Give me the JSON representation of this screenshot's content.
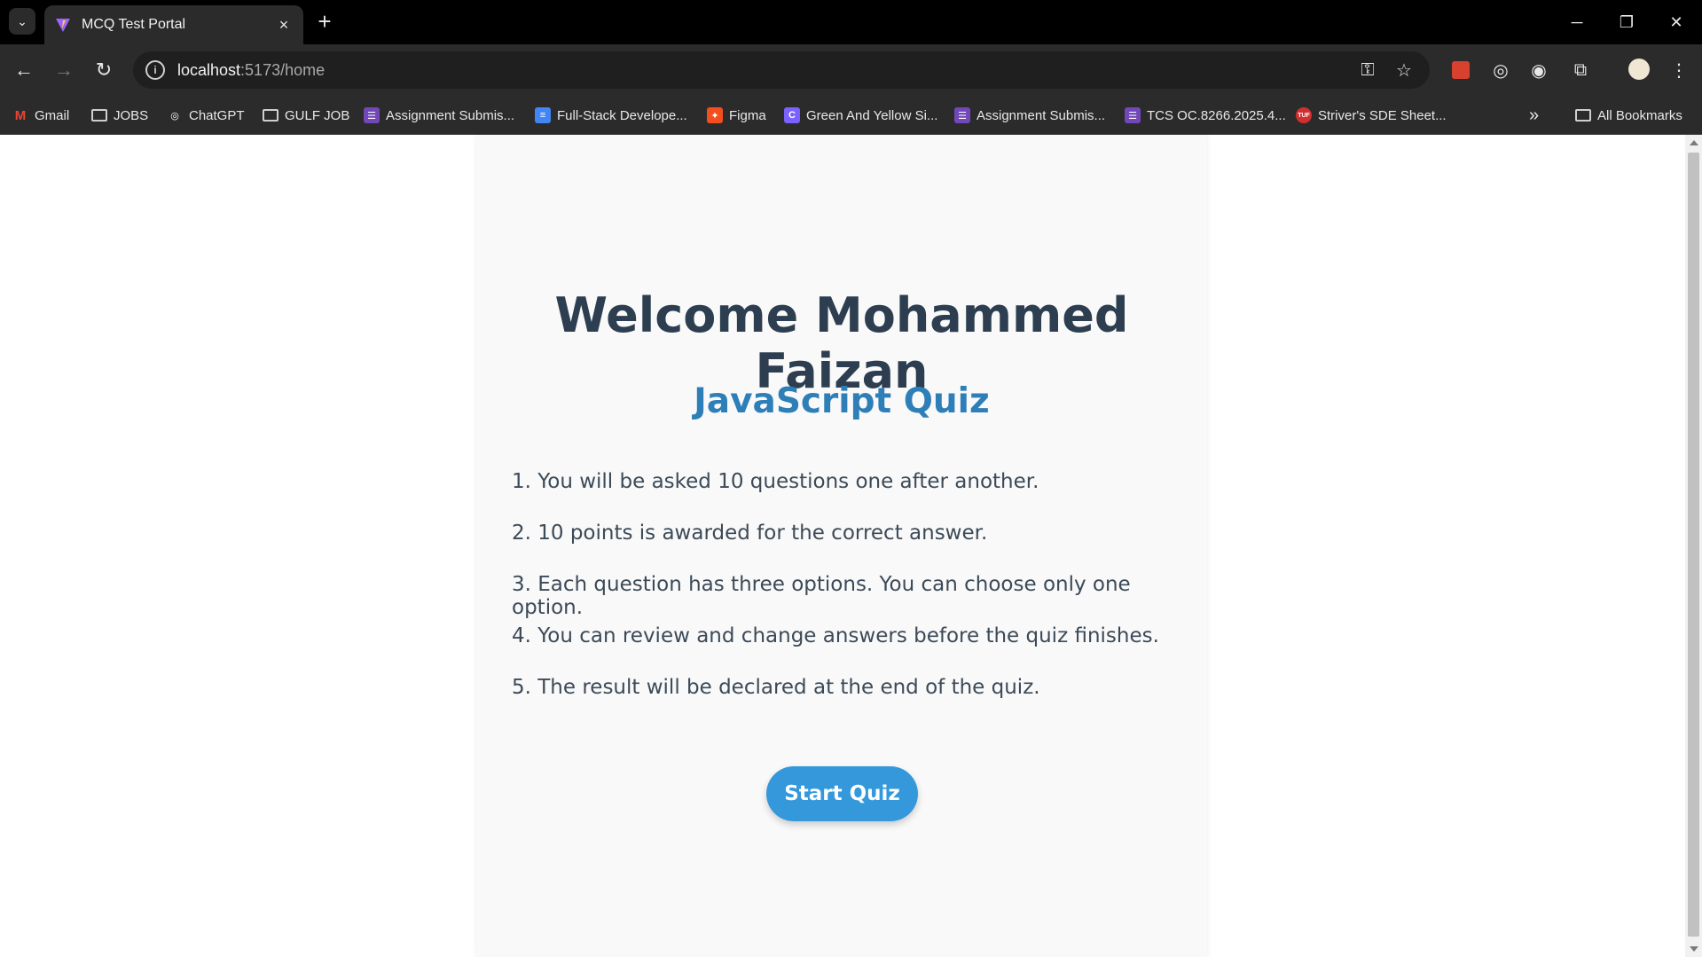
{
  "browser": {
    "tab_title": "MCQ Test Portal",
    "url_host": "localhost",
    "url_path": ":5173/home"
  },
  "bookmarks": [
    {
      "label": "Gmail",
      "icon": "gmail-icon",
      "color": "#ea4335",
      "glyph": "M"
    },
    {
      "label": "JOBS",
      "icon": "folder-icon",
      "color": "",
      "glyph": ""
    },
    {
      "label": "ChatGPT",
      "icon": "chatgpt-icon",
      "color": "#ffffff",
      "glyph": "◎"
    },
    {
      "label": "GULF JOB",
      "icon": "folder-icon",
      "color": "",
      "glyph": ""
    },
    {
      "label": "Assignment Submis...",
      "icon": "forms-icon",
      "color": "#7248b9",
      "glyph": "☰"
    },
    {
      "label": "Full-Stack Develope...",
      "icon": "docs-icon",
      "color": "#4285f4",
      "glyph": "≡"
    },
    {
      "label": "Figma",
      "icon": "figma-icon",
      "color": "#f24e1e",
      "glyph": "✦"
    },
    {
      "label": "Green And Yellow Si...",
      "icon": "canva-icon",
      "color": "#7b61ff",
      "glyph": "C"
    },
    {
      "label": "Assignment Submis...",
      "icon": "forms-icon",
      "color": "#7248b9",
      "glyph": "☰"
    },
    {
      "label": "TCS OC.8266.2025.4...",
      "icon": "forms-icon",
      "color": "#7248b9",
      "glyph": "☰"
    },
    {
      "label": "Striver's SDE Sheet...",
      "icon": "tuf-icon",
      "color": "#d32f2f",
      "glyph": "TUF"
    }
  ],
  "all_bookmarks_label": "All Bookmarks",
  "main": {
    "welcome": "Welcome Mohammed Faizan",
    "quiz_title": "JavaScript Quiz",
    "rules": [
      "1. You will be asked 10 questions one after another.",
      "2. 10 points is awarded for the correct answer.",
      "3. Each question has three options. You can choose only one option.",
      "4. You can review and change answers before the quiz finishes.",
      "5. The result will be declared at the end of the quiz."
    ],
    "start_button": "Start Quiz"
  },
  "colors": {
    "heading": "#2c3e50",
    "quiz_title": "#2e7fb8",
    "button": "#3498db"
  }
}
